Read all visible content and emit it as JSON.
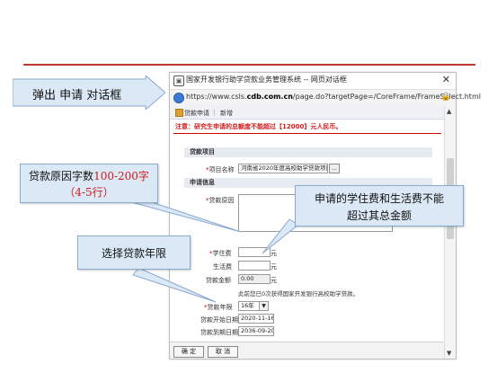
{
  "dialog": {
    "window_title": "国家开发银行助学贷款业务管理系统 -- 网页对话框",
    "url_prefix": "https://www.csls.",
    "url_domain": "cdb.com.cn",
    "url_suffix": "/page.do?targetPage=/CoreFrame/FrameSelect.html",
    "close_glyph": "✕",
    "lock_glyph": "🔒",
    "tabs": [
      "贷款申请",
      "新增"
    ],
    "tab_separator": "|",
    "notice": "注意：研究生申请的总额度不能超过【12000】元人民币。",
    "section_loan_item": "贷款项目",
    "section_apply_info": "申请信息",
    "item_name_label": "项目名称",
    "item_name_value": "河南省2020年度高校助学贷款项目",
    "item_name_button": "...",
    "reason_label": "贷款原因",
    "tuition_label": "学住费",
    "tuition_value": "",
    "living_label": "生活费",
    "living_value": "",
    "amount_label": "贷款金额",
    "amount_value": "0.00",
    "yuan": "元",
    "info_text": "此前您已0次获得国家开发银行高校助学贷款。",
    "years_label": "贷款年限",
    "years_value": "16年",
    "start_label": "贷款开始日期",
    "start_value": "2020-11-16",
    "end_label": "贷款到期日期",
    "end_value": "2036-09-20",
    "ok_button": "确 定",
    "cancel_button": "取 消",
    "required_mark": "*"
  },
  "callouts": {
    "popup": "弹出 申请 对话框",
    "reason_line1_prefix": "贷款原因字数",
    "reason_line1_highlight": "100-200字",
    "reason_line2": "（4-5行）",
    "limit_line1": "申请的学住费和生活费不能",
    "limit_line2": "超过其总金额",
    "years": "选择贷款年限"
  },
  "colors": {
    "accent_red": "#c0392b",
    "callout_fill": "#dbe8f5",
    "highlight_red": "#d01c1c"
  }
}
